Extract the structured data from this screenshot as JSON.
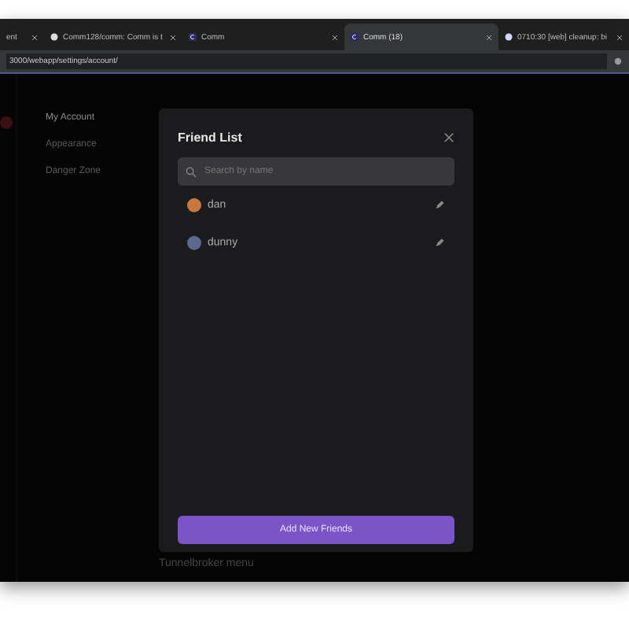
{
  "tabs": [
    {
      "title": "ent",
      "selected": false
    },
    {
      "title": "Comm128/comm: Comm is t",
      "selected": false
    },
    {
      "title": "Comm",
      "selected": false
    },
    {
      "title": "Comm (18)",
      "selected": true
    },
    {
      "title": "0710:30 [web] cleanup: bi",
      "selected": false
    }
  ],
  "address_bar": {
    "url": "3000/webapp/settings/account/"
  },
  "sidebar": {
    "items": [
      {
        "label": "My Account",
        "selected": true
      },
      {
        "label": "Appearance",
        "selected": false
      },
      {
        "label": "Danger Zone",
        "selected": false
      }
    ]
  },
  "background_text": "Tunnelbroker menu",
  "modal": {
    "title": "Friend List",
    "search": {
      "placeholder": "Search by name"
    },
    "friends": [
      {
        "name": "dan",
        "color": "#c8783c"
      },
      {
        "name": "dunny",
        "color": "#5a6a8c"
      }
    ],
    "button": "Add New Friends"
  }
}
